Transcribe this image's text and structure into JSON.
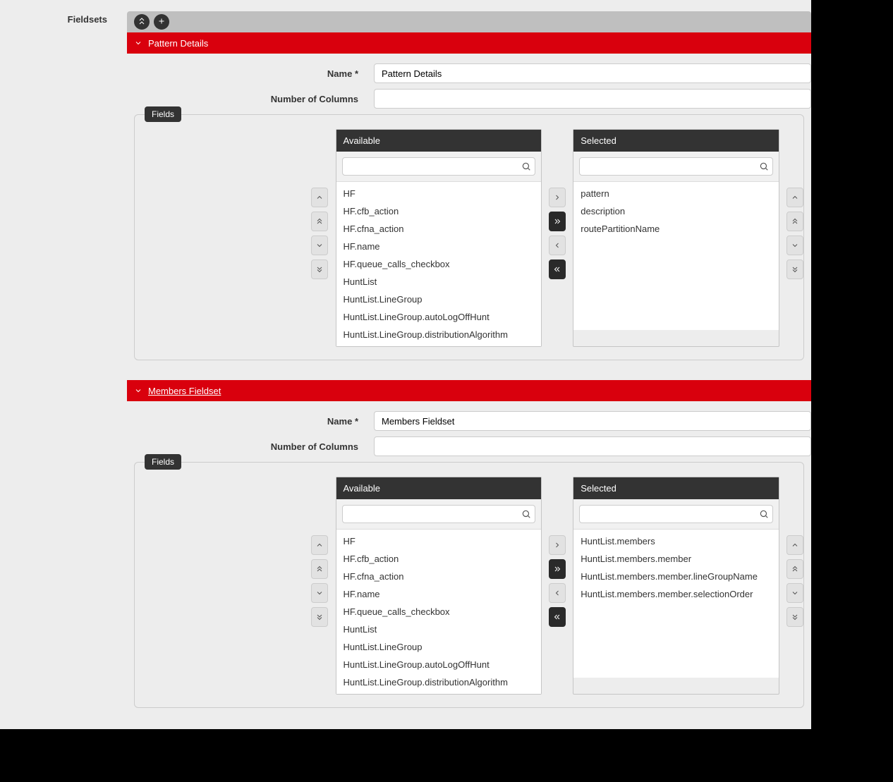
{
  "sidebar": {
    "label": "Fieldsets"
  },
  "toolbar": {
    "collapse_all_title": "Collapse all",
    "add_title": "Add"
  },
  "labels": {
    "name": "Name *",
    "num_cols": "Number of Columns",
    "fields": "Fields",
    "available": "Available",
    "selected": "Selected"
  },
  "fieldsets": [
    {
      "title": "Pattern Details",
      "title_is_link": false,
      "name_value": "Pattern Details",
      "num_cols_value": "",
      "available": [
        "HF",
        "HF.cfb_action",
        "HF.cfna_action",
        "HF.name",
        "HF.queue_calls_checkbox",
        "HuntList",
        "HuntList.LineGroup",
        "HuntList.LineGroup.autoLogOffHunt",
        "HuntList.LineGroup.distributionAlgorithm"
      ],
      "selected": [
        "pattern",
        "description",
        "routePartitionName"
      ]
    },
    {
      "title": "Members Fieldset",
      "title_is_link": true,
      "name_value": "Members Fieldset",
      "num_cols_value": "",
      "available": [
        "HF",
        "HF.cfb_action",
        "HF.cfna_action",
        "HF.name",
        "HF.queue_calls_checkbox",
        "HuntList",
        "HuntList.LineGroup",
        "HuntList.LineGroup.autoLogOffHunt",
        "HuntList.LineGroup.distributionAlgorithm"
      ],
      "selected": [
        "HuntList.members",
        "HuntList.members.member",
        "HuntList.members.member.lineGroupName",
        "HuntList.members.member.selectionOrder"
      ]
    }
  ]
}
